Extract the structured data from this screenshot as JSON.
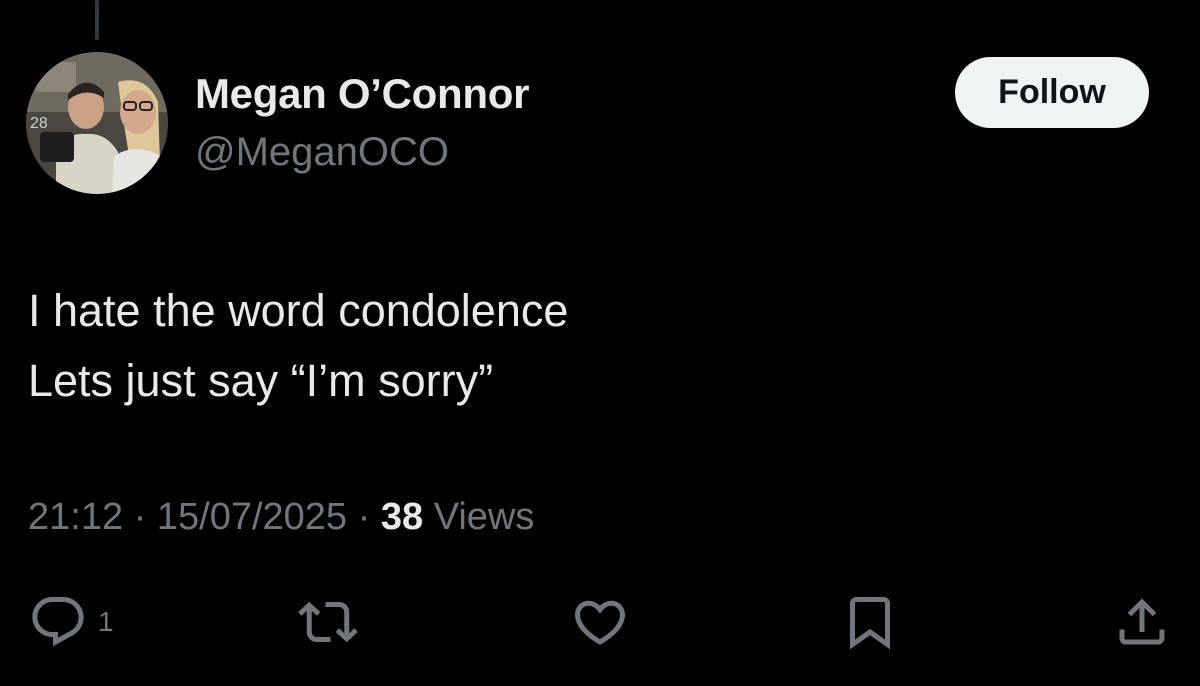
{
  "author": {
    "display_name": "Megan O’Connor",
    "handle": "@MeganOCO",
    "avatar_badge": "28"
  },
  "follow_button": {
    "label": "Follow"
  },
  "tweet": {
    "lines": [
      "I hate the word condolence",
      "Lets just say “I’m sorry”"
    ]
  },
  "meta": {
    "time": "21:12",
    "date": "15/07/2025",
    "separator": "·",
    "views_count": "38",
    "views_label": "Views"
  },
  "actions": {
    "reply": {
      "icon": "reply-icon",
      "count": "1"
    },
    "repost": {
      "icon": "repost-icon"
    },
    "like": {
      "icon": "heart-icon"
    },
    "bookmark": {
      "icon": "bookmark-icon"
    },
    "share": {
      "icon": "share-icon"
    }
  },
  "colors": {
    "background": "#000000",
    "primary_text": "#e7e9ea",
    "secondary_text": "#71767b",
    "button_bg": "#eff3f4",
    "button_text": "#0f1419"
  }
}
